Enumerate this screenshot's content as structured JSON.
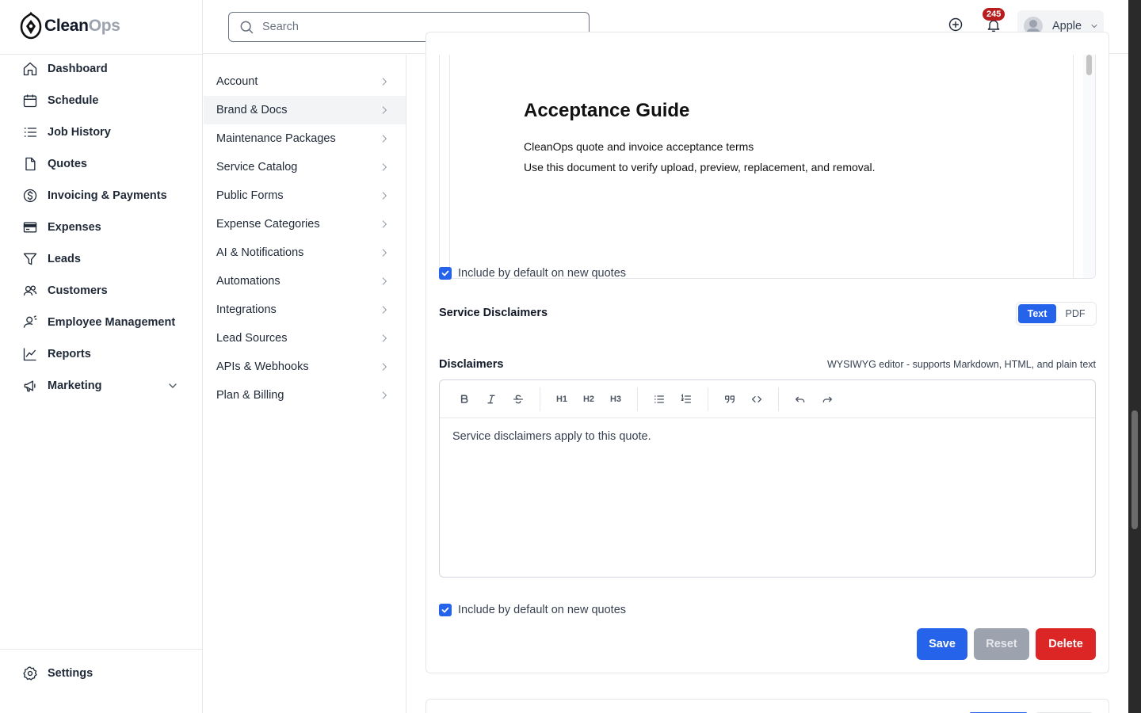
{
  "app": {
    "brand_part1": "Clean",
    "brand_part2": "Ops"
  },
  "sidebar": {
    "items": [
      {
        "label": "Dashboard",
        "icon": "home-icon"
      },
      {
        "label": "Schedule",
        "icon": "calendar-icon"
      },
      {
        "label": "Job History",
        "icon": "list-icon"
      },
      {
        "label": "Quotes",
        "icon": "document-icon"
      },
      {
        "label": "Invoicing & Payments",
        "icon": "dollar-circle-icon"
      },
      {
        "label": "Expenses",
        "icon": "receipt-icon"
      },
      {
        "label": "Leads",
        "icon": "funnel-icon"
      },
      {
        "label": "Customers",
        "icon": "users-icon"
      },
      {
        "label": "Employee Management",
        "icon": "user-gear-icon"
      },
      {
        "label": "Reports",
        "icon": "chart-line-icon"
      },
      {
        "label": "Marketing",
        "icon": "megaphone-icon"
      }
    ],
    "settings_label": "Settings"
  },
  "topbar": {
    "search_placeholder": "Search",
    "notification_count": "245",
    "user_name": "Apple"
  },
  "subnav": {
    "active": "Brand & Docs",
    "items": [
      "Account",
      "Brand & Docs",
      "Maintenance Packages",
      "Service Catalog",
      "Public Forms",
      "Expense Categories",
      "AI & Notifications",
      "Automations",
      "Integrations",
      "Lead Sources",
      "APIs & Webhooks",
      "Plan & Billing"
    ]
  },
  "document": {
    "preview_title": "Acceptance Guide",
    "preview_line1": "CleanOps quote and invoice acceptance terms",
    "preview_line2": "Use this document to verify upload, preview, replacement, and removal.",
    "include_default_label": "Include by default on new quotes",
    "include_default_checked": true
  },
  "disclaimers": {
    "section_title": "Service Disclaimers",
    "mode_options": [
      "Text",
      "PDF"
    ],
    "mode_selected": "Text",
    "field_label": "Disclaimers",
    "editor_hint": "WYSIWYG editor - supports Markdown, HTML, and plain text",
    "toolbar": [
      "bold-icon",
      "italic-icon",
      "strikethrough-icon",
      "heading-1-icon",
      "heading-2-icon",
      "heading-3-icon",
      "bullet-list-icon",
      "ordered-list-icon",
      "quote-icon",
      "code-icon",
      "undo-icon",
      "redo-icon"
    ],
    "toolbar_labels": {
      "h1": "H1",
      "h2": "H2",
      "h3": "H3"
    },
    "content": "Service disclaimers apply to this quote.",
    "include_default_label": "Include by default on new quotes",
    "include_default_checked": true
  },
  "actions": {
    "save": "Save",
    "reset": "Reset",
    "delete": "Delete"
  },
  "colors": {
    "primary": "#2563eb",
    "danger": "#dc2626",
    "badge": "#b91c1c",
    "disabled": "#9ca3af"
  }
}
